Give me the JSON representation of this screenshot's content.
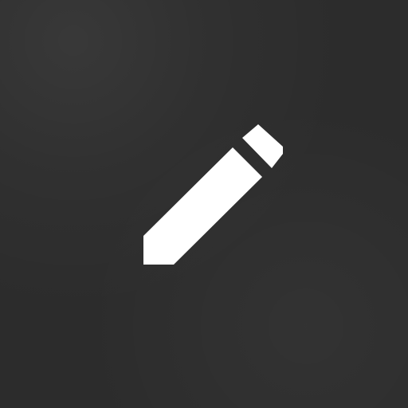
{
  "tile": {
    "icon": "pencil-icon",
    "background_color": "#2c2c2c",
    "icon_color": "#ffffff"
  }
}
